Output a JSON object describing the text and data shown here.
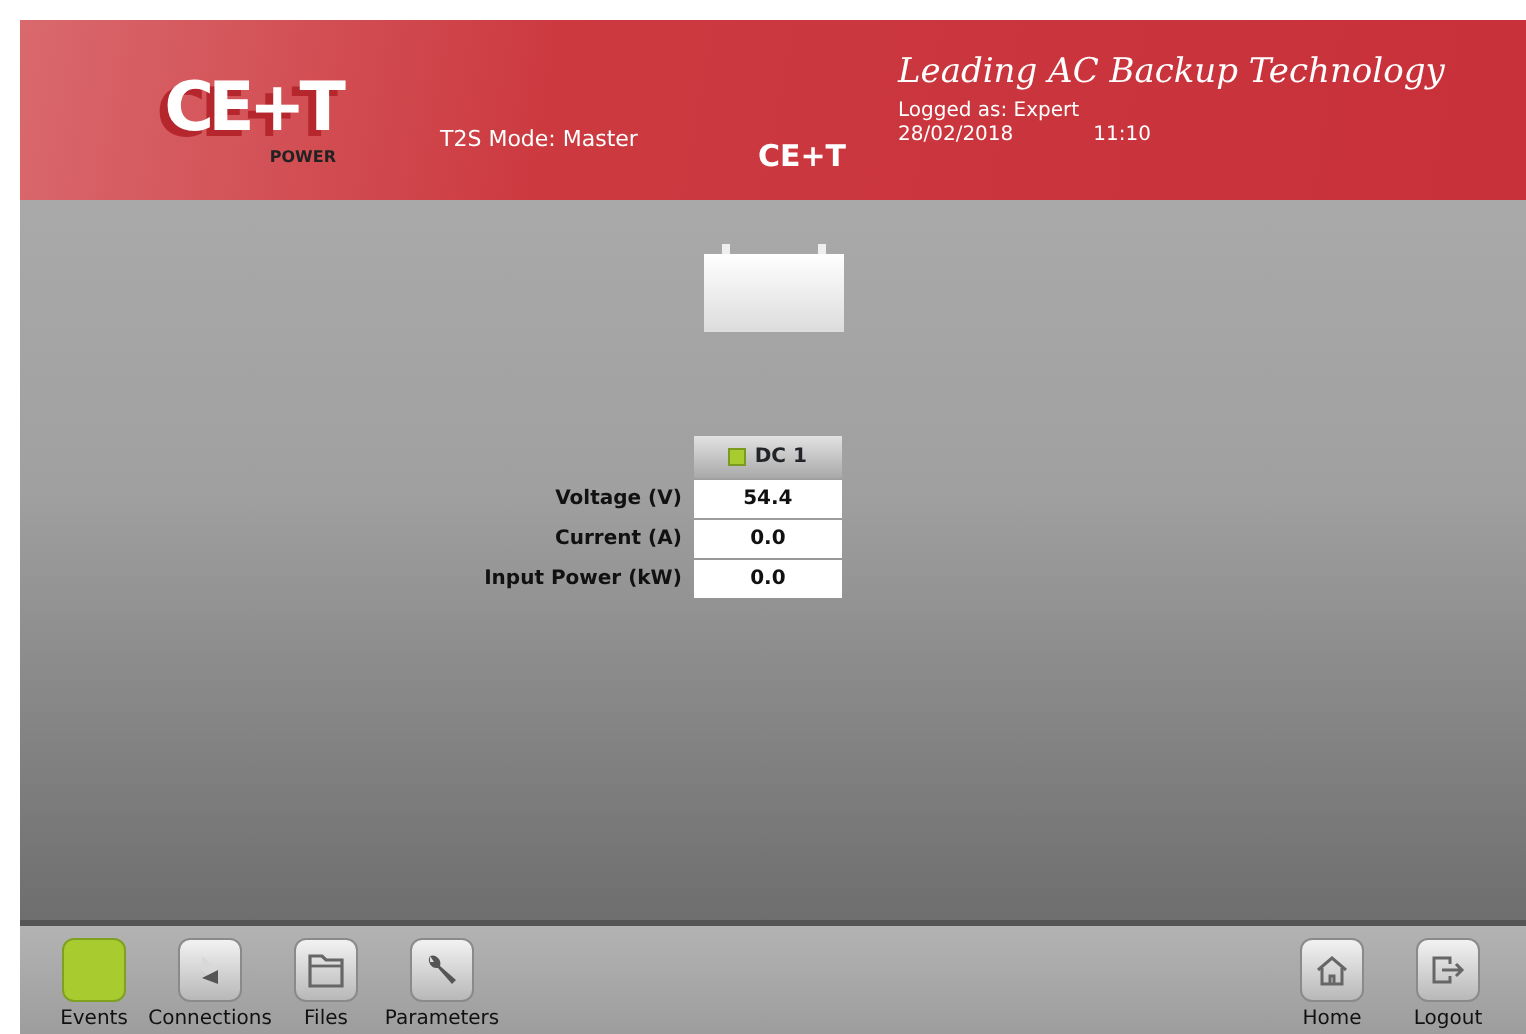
{
  "header": {
    "logo": {
      "mark": "CE+T",
      "sub": "POWER"
    },
    "mode": "T2S Mode: Master",
    "tagline": "Leading AC Backup Technology",
    "site": "CE+T",
    "user": "Logged as: Expert",
    "date": "28/02/2018",
    "time": "11:10"
  },
  "source": {
    "name": "DC 1",
    "color": "#a8cc30"
  },
  "measurements": [
    {
      "label": "Voltage (V)",
      "value": "54.4"
    },
    {
      "label": "Current (A)",
      "value": "0.0"
    },
    {
      "label": "Input Power (kW)",
      "value": "0.0"
    }
  ],
  "footer_left": [
    {
      "kind": "status",
      "label": "Events",
      "color": "#a8cc30"
    },
    {
      "kind": "connections",
      "label": "Connections"
    },
    {
      "kind": "files",
      "label": "Files"
    },
    {
      "kind": "parameters",
      "label": "Parameters"
    }
  ],
  "footer_right": [
    {
      "kind": "home",
      "label": "Home"
    },
    {
      "kind": "logout",
      "label": "Logout"
    }
  ]
}
